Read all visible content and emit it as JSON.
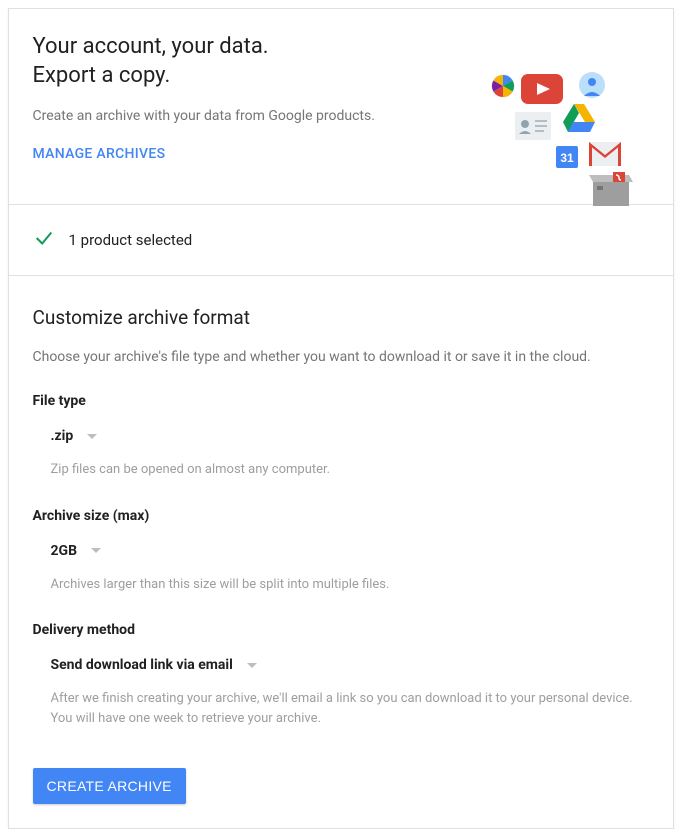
{
  "header": {
    "title_line1": "Your account, your data.",
    "title_line2": "Export a copy.",
    "subtitle": "Create an archive with your data from Google products.",
    "manage_link": "MANAGE ARCHIVES"
  },
  "selected": {
    "text": "1 product selected"
  },
  "customize": {
    "title": "Customize archive format",
    "desc": "Choose your archive's file type and whether you want to download it or save it in the cloud.",
    "file_type": {
      "label": "File type",
      "value": ".zip",
      "help": "Zip files can be opened on almost any computer."
    },
    "archive_size": {
      "label": "Archive size (max)",
      "value": "2GB",
      "help": "Archives larger than this size will be split into multiple files."
    },
    "delivery": {
      "label": "Delivery method",
      "value": "Send download link via email",
      "help": "After we finish creating your archive, we'll email a link so you can download it to your personal device. You will have one week to retrieve your archive."
    },
    "create_button": "CREATE ARCHIVE"
  }
}
